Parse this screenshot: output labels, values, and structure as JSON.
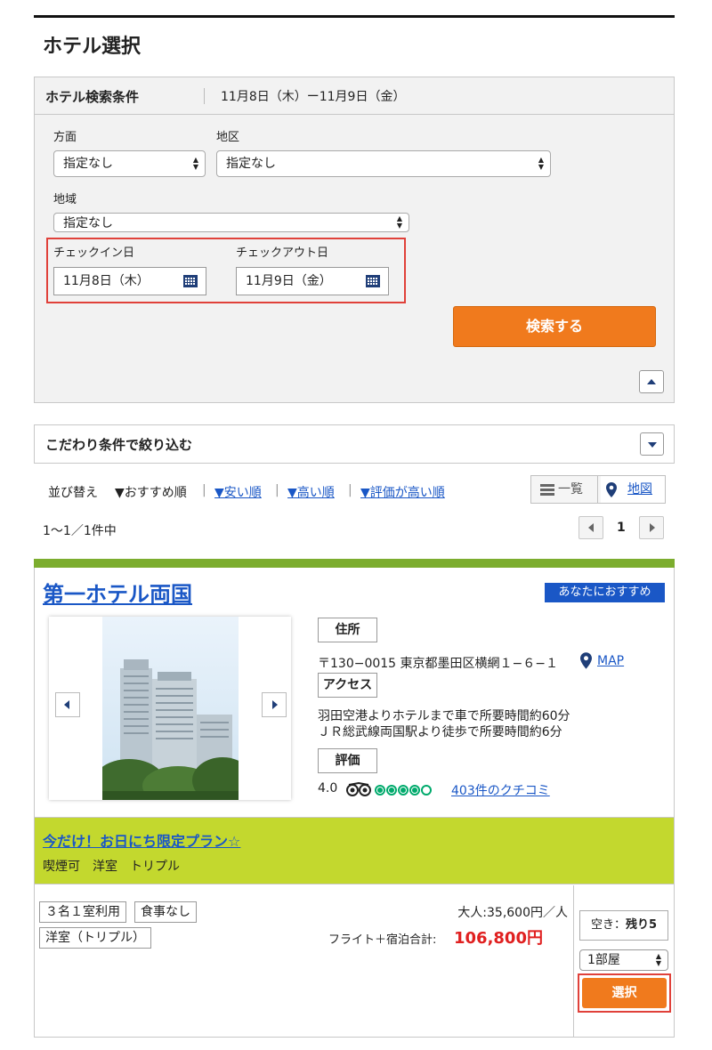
{
  "page": {
    "title": "ホテル選択"
  },
  "search_panel": {
    "heading": "ホテル検索条件",
    "date_range": "11月8日（木）ー11月9日（金）",
    "direction": {
      "label": "方面",
      "value": "指定なし"
    },
    "district": {
      "label": "地区",
      "value": "指定なし"
    },
    "area": {
      "label": "地域",
      "value": "指定なし"
    },
    "checkin": {
      "label": "チェックイン日",
      "value": "11月8日（木）"
    },
    "checkout": {
      "label": "チェックアウト日",
      "value": "11月9日（金）"
    },
    "search_button": "検索する"
  },
  "filter": {
    "heading": "こだわり条件で絞り込む"
  },
  "sort": {
    "label": "並び替え",
    "current": "▼おすすめ順",
    "options": [
      "▼安い順",
      "▼高い順",
      "▼評価が高い順"
    ]
  },
  "view": {
    "list": "一覧",
    "map": "地図"
  },
  "results": {
    "count_text": "1〜1／1件中",
    "current_page": "1"
  },
  "hotel": {
    "name": "第一ホテル両国",
    "badge": "あなたにおすすめ",
    "address_tag": "住所",
    "address": "〒130−0015 東京都墨田区横網１−６−１",
    "map_link": "MAP",
    "access_tag": "アクセス",
    "access_line1": "羽田空港よりホテルまで車で所要時間約60分",
    "access_line2": "ＪＲ総武線両国駅より徒歩で所要時間約6分",
    "rating_tag": "評価",
    "rating": "4.0",
    "reviews_link": "403件のクチコミ"
  },
  "plan": {
    "title": "今だけ！お日にち限定プラン☆",
    "subtitle": "喫煙可　洋室　トリプル",
    "tags": [
      "３名１室利用",
      "食事なし",
      "洋室（トリプル）"
    ],
    "adult_price": "大人:35,600円／人",
    "total_label": "フライト＋宿泊合計:",
    "total_price": "106,800円",
    "availability_label": "空き：",
    "availability_value": "残り5",
    "rooms_value": "1部屋",
    "select_button": "選択"
  },
  "colors": {
    "accent_orange": "#f07a1d",
    "link_blue": "#1a57c6",
    "green_bar": "#7cad2e",
    "plan_bg": "#c3d82e",
    "price_red": "#e02020"
  }
}
